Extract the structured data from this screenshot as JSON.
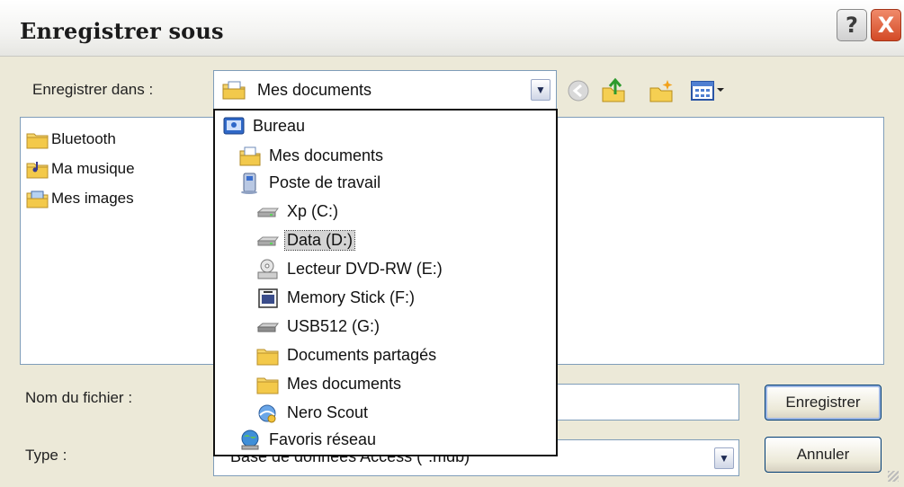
{
  "window": {
    "title": "Enregistrer sous",
    "help_label": "?",
    "close_label": "X"
  },
  "save_in": {
    "label": "Enregistrer dans :",
    "value": "Mes documents",
    "icon": "my-documents-icon"
  },
  "toolbar": {
    "icons": [
      "back-icon",
      "up-folder-icon",
      "new-folder-icon",
      "view-menu-icon"
    ]
  },
  "files": [
    {
      "label": "Bluetooth",
      "icon": "folder-icon"
    },
    {
      "label": "Ma musique",
      "icon": "music-folder-icon"
    },
    {
      "label": "Mes images",
      "icon": "pictures-folder-icon"
    }
  ],
  "dropdown": {
    "items": [
      {
        "label": "Bureau",
        "icon": "desktop-icon",
        "level": 0,
        "selected": false
      },
      {
        "label": "Mes documents",
        "icon": "my-documents-icon",
        "level": 1,
        "selected": false
      },
      {
        "label": "Poste de travail",
        "icon": "computer-icon",
        "level": 1,
        "selected": false
      },
      {
        "label": "Xp (C:)",
        "icon": "hard-drive-icon",
        "level": 2,
        "selected": false
      },
      {
        "label": "Data (D:)",
        "icon": "hard-drive-icon",
        "level": 2,
        "selected": true
      },
      {
        "label": "Lecteur DVD-RW (E:)",
        "icon": "dvd-drive-icon",
        "level": 2,
        "selected": false
      },
      {
        "label": "Memory Stick (F:)",
        "icon": "memory-stick-icon",
        "level": 2,
        "selected": false
      },
      {
        "label": "USB512 (G:)",
        "icon": "usb-drive-icon",
        "level": 2,
        "selected": false
      },
      {
        "label": "Documents partagés",
        "icon": "folder-icon",
        "level": 2,
        "selected": false
      },
      {
        "label": "Mes documents",
        "icon": "folder-icon",
        "level": 2,
        "selected": false
      },
      {
        "label": "Nero Scout",
        "icon": "nero-scout-icon",
        "level": 2,
        "selected": false
      },
      {
        "label": "Favoris réseau",
        "icon": "network-places-icon",
        "level": 1,
        "selected": false
      }
    ]
  },
  "filename": {
    "label": "Nom du fichier :",
    "value": ""
  },
  "filetype": {
    "label": "Type :",
    "value": "Base de données Access (*.mdb)"
  },
  "buttons": {
    "save": "Enregistrer",
    "cancel": "Annuler"
  }
}
